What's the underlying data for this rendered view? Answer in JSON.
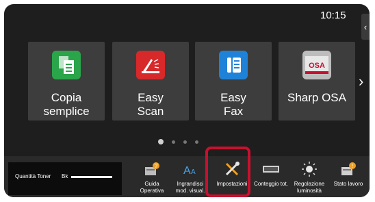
{
  "status": {
    "time": "10:15"
  },
  "apps": [
    {
      "label": "Copia\nsemplice",
      "icon": "copy-icon",
      "color": "#2aa54a"
    },
    {
      "label": "Easy\nScan",
      "icon": "scan-icon",
      "color": "#d7282a"
    },
    {
      "label": "Easy\nFax",
      "icon": "fax-icon",
      "color": "#1e82d8"
    },
    {
      "label": "Sharp OSA",
      "icon": "osa-icon",
      "color": "#c8102e"
    }
  ],
  "pager": {
    "pages": 4,
    "active": 1
  },
  "toner": {
    "label": "Quantità Toner",
    "color_label": "Bk"
  },
  "shortcuts": [
    {
      "label": "Guida\nOperativa",
      "icon": "guide-icon"
    },
    {
      "label": "Ingrandisci\nmod. visual.",
      "icon": "text-size-icon"
    },
    {
      "label": "Impostazioni",
      "icon": "wrench-screwdriver-icon"
    },
    {
      "label": "Conteggio tot.",
      "icon": "counter-icon"
    },
    {
      "label": "Regolazione\nluminosità",
      "icon": "brightness-icon"
    },
    {
      "label": "Stato lavoro",
      "icon": "job-status-icon"
    }
  ]
}
